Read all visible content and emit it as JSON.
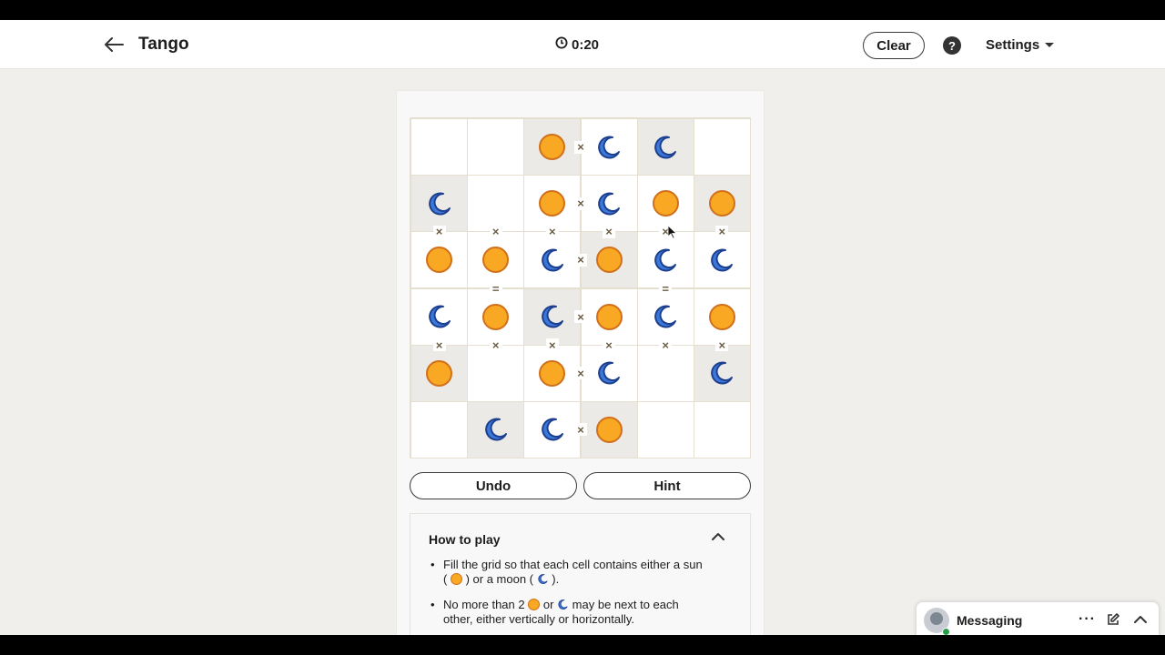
{
  "header": {
    "title": "Tango",
    "timer": "0:20",
    "clear_label": "Clear",
    "help_label": "?",
    "settings_label": "Settings"
  },
  "board": {
    "size": 6,
    "symbols": {
      "S": "sun",
      "M": "moon",
      "": "empty"
    },
    "cells": [
      [
        "",
        "",
        "S",
        "M",
        "M",
        ""
      ],
      [
        "M",
        "",
        "S",
        "M",
        "S",
        "S"
      ],
      [
        "S",
        "S",
        "M",
        "S",
        "M",
        "M"
      ],
      [
        "M",
        "S",
        "M",
        "S",
        "M",
        "S"
      ],
      [
        "S",
        "",
        "S",
        "M",
        "",
        "M"
      ],
      [
        "",
        "M",
        "M",
        "S",
        "",
        ""
      ]
    ],
    "locked": [
      [
        false,
        false,
        true,
        false,
        true,
        false
      ],
      [
        true,
        false,
        false,
        false,
        false,
        true
      ],
      [
        false,
        false,
        false,
        true,
        false,
        false
      ],
      [
        false,
        false,
        true,
        false,
        false,
        false
      ],
      [
        true,
        false,
        false,
        false,
        false,
        true
      ],
      [
        false,
        true,
        false,
        true,
        false,
        false
      ]
    ],
    "constraints": [
      {
        "between": [
          [
            0,
            2
          ],
          [
            0,
            3
          ]
        ],
        "sign": "×"
      },
      {
        "between": [
          [
            1,
            2
          ],
          [
            1,
            3
          ]
        ],
        "sign": "×"
      },
      {
        "between": [
          [
            1,
            0
          ],
          [
            2,
            0
          ]
        ],
        "sign": "×"
      },
      {
        "between": [
          [
            1,
            1
          ],
          [
            2,
            1
          ]
        ],
        "sign": "×"
      },
      {
        "between": [
          [
            1,
            2
          ],
          [
            2,
            2
          ]
        ],
        "sign": "×"
      },
      {
        "between": [
          [
            1,
            3
          ],
          [
            2,
            3
          ]
        ],
        "sign": "×"
      },
      {
        "between": [
          [
            1,
            4
          ],
          [
            2,
            4
          ]
        ],
        "sign": "×"
      },
      {
        "between": [
          [
            1,
            5
          ],
          [
            2,
            5
          ]
        ],
        "sign": "×"
      },
      {
        "between": [
          [
            2,
            2
          ],
          [
            2,
            3
          ]
        ],
        "sign": "×"
      },
      {
        "between": [
          [
            2,
            1
          ],
          [
            3,
            1
          ]
        ],
        "sign": "="
      },
      {
        "between": [
          [
            2,
            4
          ],
          [
            3,
            4
          ]
        ],
        "sign": "="
      },
      {
        "between": [
          [
            3,
            2
          ],
          [
            3,
            3
          ]
        ],
        "sign": "×"
      },
      {
        "between": [
          [
            3,
            0
          ],
          [
            4,
            0
          ]
        ],
        "sign": "×"
      },
      {
        "between": [
          [
            3,
            1
          ],
          [
            4,
            1
          ]
        ],
        "sign": "×"
      },
      {
        "between": [
          [
            3,
            2
          ],
          [
            4,
            2
          ]
        ],
        "sign": "×"
      },
      {
        "between": [
          [
            3,
            3
          ],
          [
            4,
            3
          ]
        ],
        "sign": "×"
      },
      {
        "between": [
          [
            3,
            4
          ],
          [
            4,
            4
          ]
        ],
        "sign": "×"
      },
      {
        "between": [
          [
            3,
            5
          ],
          [
            4,
            5
          ]
        ],
        "sign": "×"
      },
      {
        "between": [
          [
            4,
            2
          ],
          [
            4,
            3
          ]
        ],
        "sign": "×"
      },
      {
        "between": [
          [
            5,
            2
          ],
          [
            5,
            3
          ]
        ],
        "sign": "×"
      }
    ],
    "colors": {
      "sun_fill": "#f8a823",
      "sun_stroke": "#d1701b",
      "moon_fill": "#3c78d8",
      "moon_stroke": "#1d3f8f",
      "locked_bg": "#eceae6"
    }
  },
  "controls": {
    "undo_label": "Undo",
    "hint_label": "Hint"
  },
  "how_to_play": {
    "heading": "How to play",
    "rule1_part1": "Fill the grid so that each cell contains either a sun",
    "rule1_part2": "(",
    "rule1_part3": ") or a moon (",
    "rule1_part4": ").",
    "rule2_part1": "No more than 2",
    "rule2_part2": "or",
    "rule2_part3": "may be next to each",
    "rule2_part4": "other, either vertically or horizontally."
  },
  "messaging": {
    "label": "Messaging",
    "more_label": "···"
  }
}
